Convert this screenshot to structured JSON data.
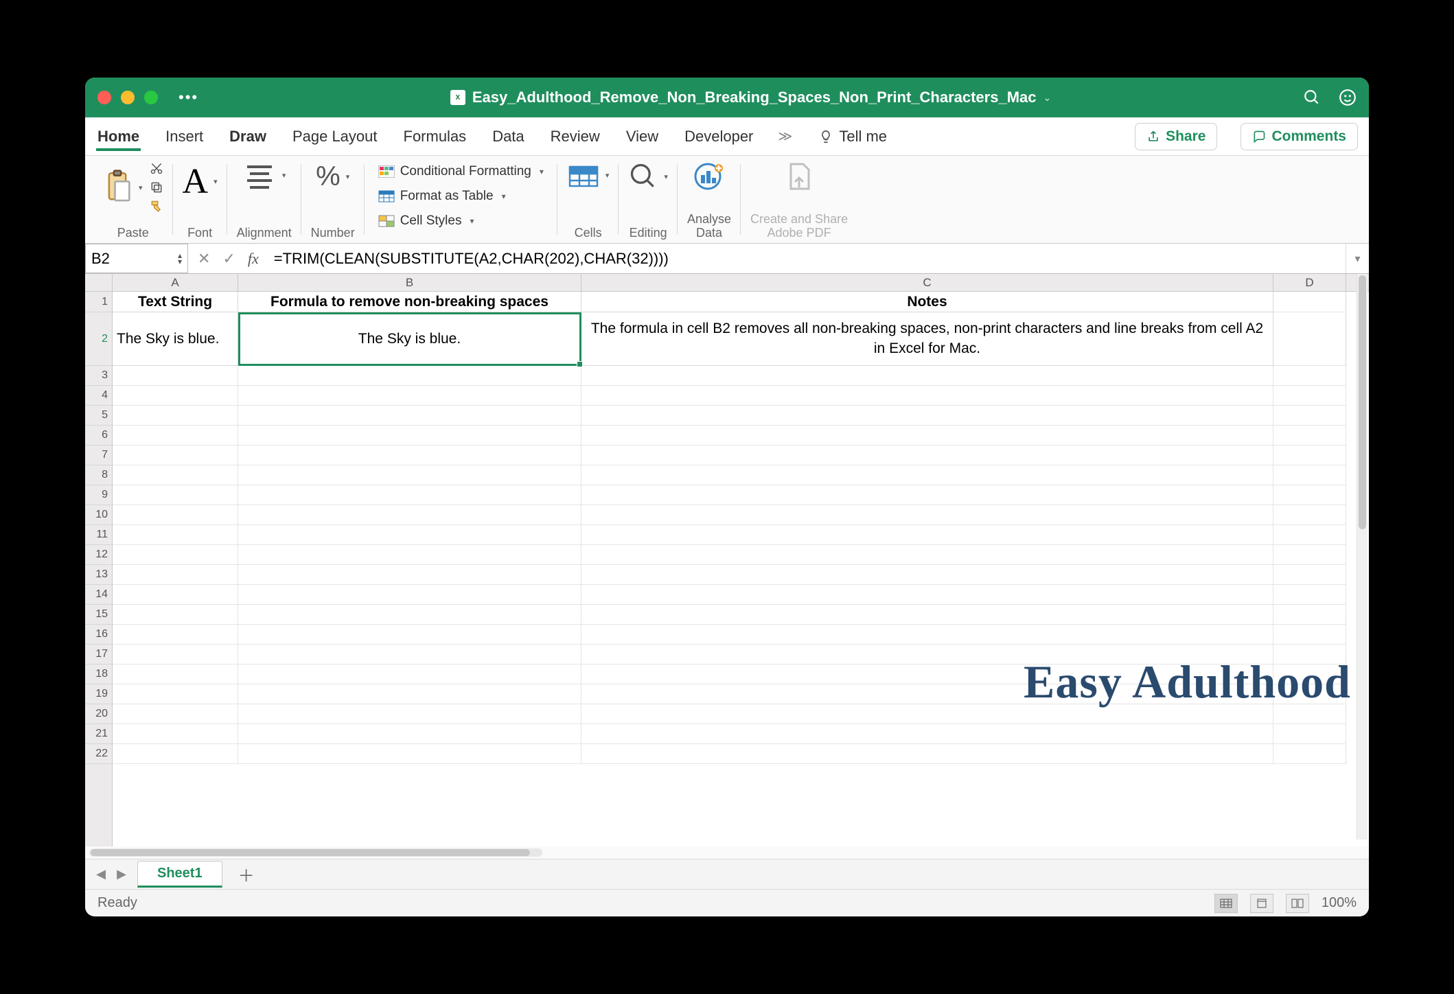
{
  "titlebar": {
    "document_title": "Easy_Adulthood_Remove_Non_Breaking_Spaces_Non_Print_Characters_Mac"
  },
  "ribbon_tabs": {
    "home": "Home",
    "insert": "Insert",
    "draw": "Draw",
    "page_layout": "Page Layout",
    "formulas": "Formulas",
    "data": "Data",
    "review": "Review",
    "view": "View",
    "developer": "Developer",
    "tell_me": "Tell me",
    "share": "Share",
    "comments": "Comments"
  },
  "ribbon_groups": {
    "paste": "Paste",
    "font": "Font",
    "alignment": "Alignment",
    "number": "Number",
    "cond_formatting": "Conditional Formatting",
    "format_as_table": "Format as Table",
    "cell_styles": "Cell Styles",
    "cells": "Cells",
    "editing": "Editing",
    "analyse_data": "Analyse Data",
    "create_share_pdf_l1": "Create and Share",
    "create_share_pdf_l2": "Adobe PDF"
  },
  "name_box": {
    "value": "B2"
  },
  "formula_bar": {
    "value": "=TRIM(CLEAN(SUBSTITUTE(A2,CHAR(202),CHAR(32))))"
  },
  "columns": {
    "A": "A",
    "B": "B",
    "C": "C",
    "D": "D"
  },
  "cells": {
    "A1": "Text String",
    "B1": "Formula to remove non-breaking spaces",
    "C1": "Notes",
    "A2": "The Sky is blue.",
    "B2": "The Sky is blue.",
    "C2": "The formula in cell B2 removes all non-breaking spaces, non-print characters and line breaks from cell A2 in Excel for Mac."
  },
  "watermark": "Easy Adulthood",
  "sheet_tabs": {
    "sheet1": "Sheet1"
  },
  "status_bar": {
    "ready": "Ready",
    "zoom": "100%"
  }
}
